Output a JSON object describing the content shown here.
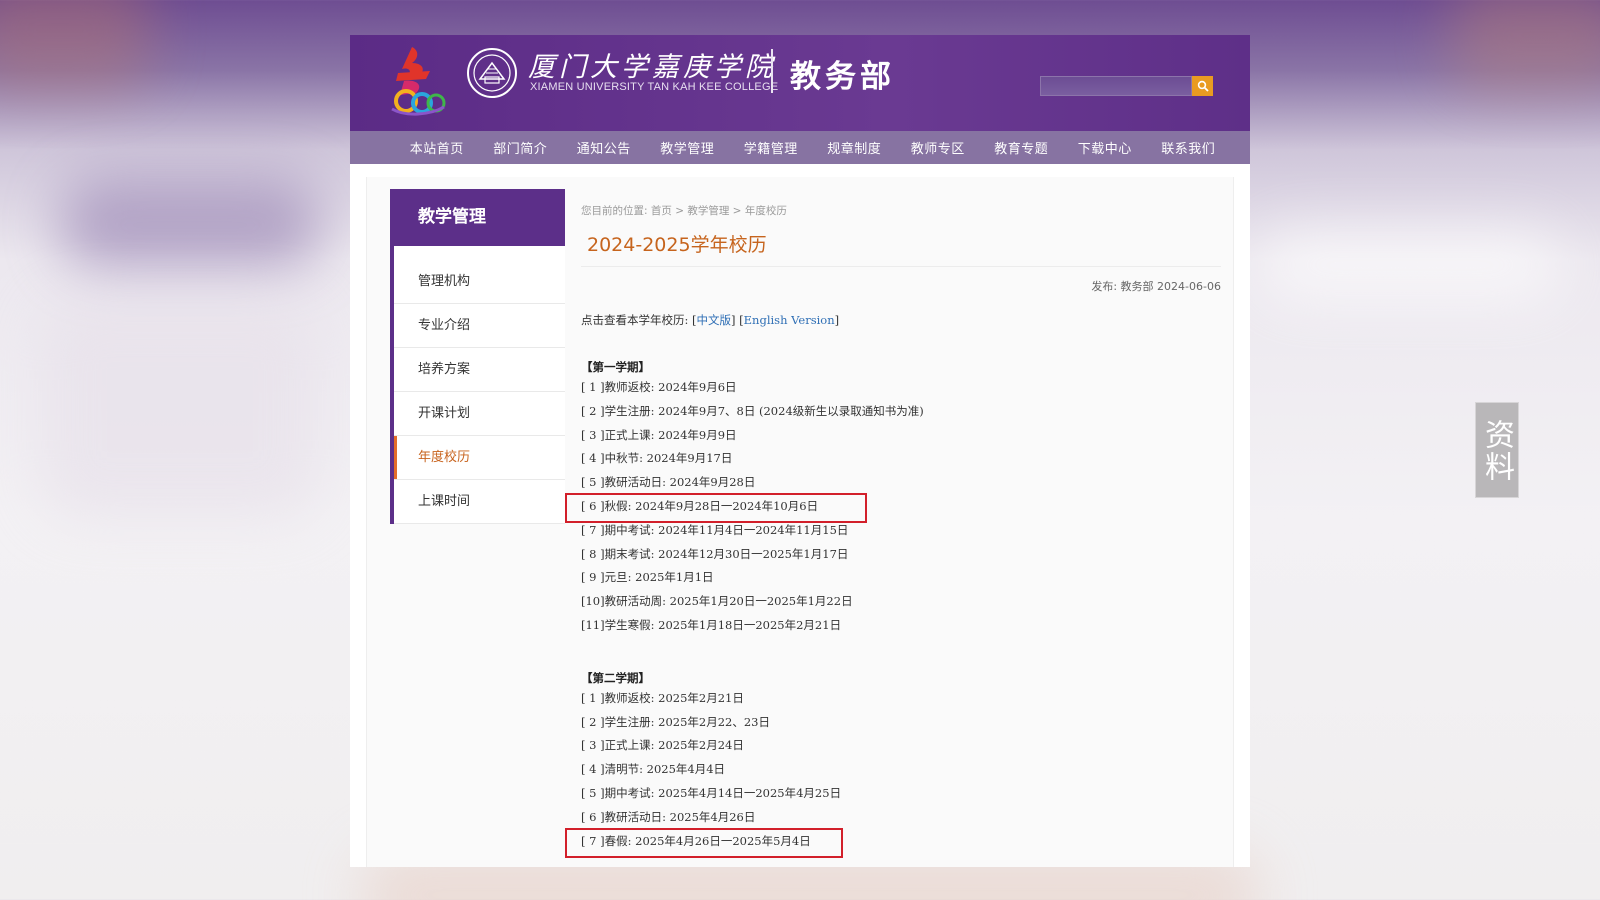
{
  "header": {
    "college_cn": "厦门大学嘉庚学院",
    "college_en": "XIAMEN UNIVERSITY TAN KAH KEE COLLEGE",
    "dept_name": "教务部",
    "search_placeholder": ""
  },
  "nav": {
    "items": [
      "本站首页",
      "部门简介",
      "通知公告",
      "教学管理",
      "学籍管理",
      "规章制度",
      "教师专区",
      "教育专题",
      "下载中心",
      "联系我们"
    ]
  },
  "sidebar": {
    "title": "教学管理",
    "items": [
      "管理机构",
      "专业介绍",
      "培养方案",
      "开课计划",
      "年度校历",
      "上课时间"
    ],
    "active_index": 4
  },
  "article": {
    "breadcrumb": "您目前的位置: 首页 > 教学管理 > 年度校历",
    "title": "2024-2025学年校历",
    "publish": "发布: 教务部  2024-06-06",
    "view_prefix": "点击查看本学年校历: [",
    "view_cn": "中文版",
    "view_mid": "] [",
    "view_en": "English Version",
    "view_suffix": "]"
  },
  "semester1": {
    "heading": "【第一学期】",
    "items": [
      "[ 1 ]教师返校: 2024年9月6日",
      "[ 2 ]学生注册: 2024年9月7、8日 (2024级新生以录取通知书为准)",
      "[ 3 ]正式上课: 2024年9月9日",
      "[ 4 ]中秋节: 2024年9月17日",
      "[ 5 ]教研活动日: 2024年9月28日",
      "[ 6 ]秋假: 2024年9月28日一2024年10月6日",
      "[ 7 ]期中考试: 2024年11月4日一2024年11月15日",
      "[ 8 ]期末考试: 2024年12月30日一2025年1月17日",
      "[ 9 ]元旦: 2025年1月1日",
      "[10]教研活动周: 2025年1月20日一2025年1月22日",
      "[11]学生寒假: 2025年1月18日一2025年2月21日"
    ]
  },
  "semester2": {
    "heading": "【第二学期】",
    "items": [
      "[ 1 ]教师返校: 2025年2月21日",
      "[ 2 ]学生注册: 2025年2月22、23日",
      "[ 3 ]正式上课: 2025年2月24日",
      "[ 4 ]清明节: 2025年4月4日",
      "[ 5 ]期中考试: 2025年4月14日一2025年4月25日",
      "[ 6 ]教研活动日: 2025年4月26日",
      "[ 7 ]春假: 2025年4月26日一2025年5月4日"
    ]
  },
  "overlay_tag": "资料",
  "colors": {
    "header_purple": "#5b2b86",
    "nav_purple": "#8773a2",
    "title_orange": "#c6641d",
    "highlight_red": "#d21f2a",
    "search_orange": "#e99b21"
  }
}
